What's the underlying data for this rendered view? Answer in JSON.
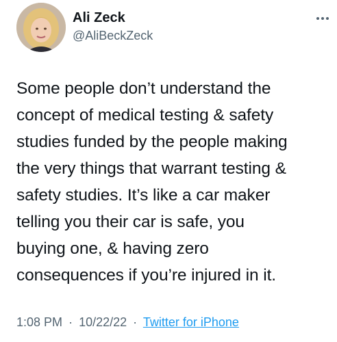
{
  "author": {
    "display_name": "Ali Zeck",
    "handle": "@AliBeckZeck",
    "avatar_icon": "profile-photo"
  },
  "more_icon": "ellipsis-icon",
  "tweet": {
    "text": "Some people don’t understand the\nconcept of medical testing & safety\nstudies funded by the people making\nthe very things that warrant testing &\nsafety studies. It’s like a car maker\ntelling you their car is safe, you\nbuying one, & having zero\nconsequences if you’re injured in it."
  },
  "meta": {
    "time": "1:08 PM",
    "separator": "·",
    "date": "10/22/22",
    "source": "Twitter for iPhone"
  },
  "colors": {
    "text": "#0f1419",
    "secondary": "#536471",
    "link": "#1d9bf0",
    "background": "#ffffff"
  }
}
